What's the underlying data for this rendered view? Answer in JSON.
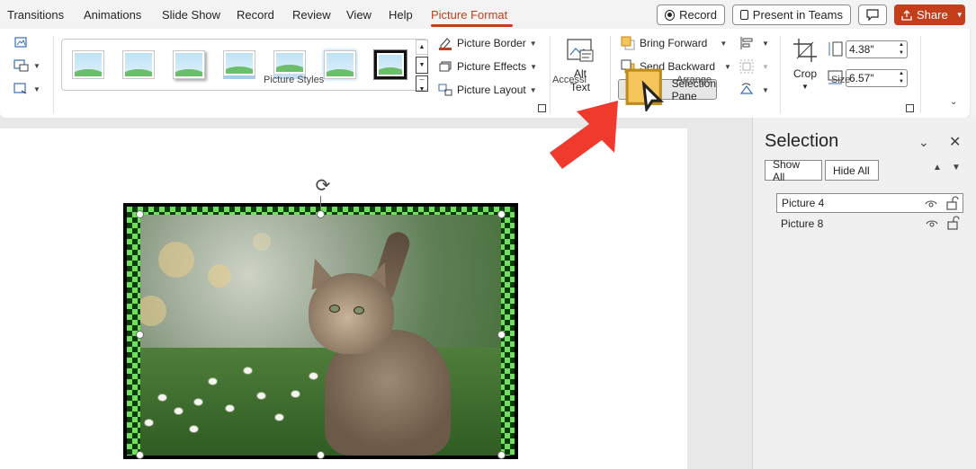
{
  "menubar": {
    "tabs": [
      "Transitions",
      "Animations",
      "Slide Show",
      "Record",
      "Review",
      "View",
      "Help",
      "Picture Format"
    ],
    "record_label": "Record",
    "present_label": "Present in Teams",
    "share_label": "Share"
  },
  "ribbon": {
    "picture_styles_label": "Picture Styles",
    "picture_border": "Picture Border",
    "picture_effects": "Picture Effects",
    "picture_layout": "Picture Layout",
    "alt_text_line1": "Alt",
    "alt_text_line2": "Text",
    "accessibility_label": "Accessi",
    "bring_forward": "Bring Forward",
    "send_backward": "Send Backward",
    "selection_pane": "Selection Pane",
    "arrange_label": "Arrange",
    "crop_label": "Crop",
    "height_value": "4.38\"",
    "width_value": "6.57\"",
    "size_label": "Size"
  },
  "selection_pane": {
    "title": "Selection",
    "show_all": "Show All",
    "hide_all": "Hide All",
    "items": [
      {
        "label": "Picture 4",
        "selected": true
      },
      {
        "label": "Picture 8",
        "selected": false
      }
    ]
  },
  "colors": {
    "accent": "#c43e1c",
    "arrow": "#f03a2e"
  }
}
